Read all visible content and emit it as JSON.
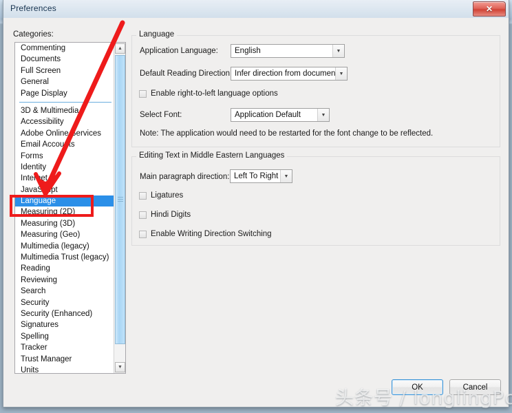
{
  "window": {
    "title": "Preferences",
    "close_label": "✕"
  },
  "sidebar": {
    "label": "Categories:",
    "items": [
      {
        "label": "Commenting",
        "selected": false
      },
      {
        "label": "Documents",
        "selected": false
      },
      {
        "label": "Full Screen",
        "selected": false
      },
      {
        "label": "General",
        "selected": false
      },
      {
        "label": "Page Display",
        "selected": false
      },
      {
        "separator": true
      },
      {
        "label": "3D & Multimedia",
        "selected": false
      },
      {
        "label": "Accessibility",
        "selected": false
      },
      {
        "label": "Adobe Online Services",
        "selected": false
      },
      {
        "label": "Email Accounts",
        "selected": false
      },
      {
        "label": "Forms",
        "selected": false
      },
      {
        "label": "Identity",
        "selected": false
      },
      {
        "label": "Internet",
        "selected": false
      },
      {
        "label": "JavaScript",
        "selected": false
      },
      {
        "label": "Language",
        "selected": true
      },
      {
        "label": "Measuring (2D)",
        "selected": false
      },
      {
        "label": "Measuring (3D)",
        "selected": false
      },
      {
        "label": "Measuring (Geo)",
        "selected": false
      },
      {
        "label": "Multimedia (legacy)",
        "selected": false
      },
      {
        "label": "Multimedia Trust (legacy)",
        "selected": false
      },
      {
        "label": "Reading",
        "selected": false
      },
      {
        "label": "Reviewing",
        "selected": false
      },
      {
        "label": "Search",
        "selected": false
      },
      {
        "label": "Security",
        "selected": false
      },
      {
        "label": "Security (Enhanced)",
        "selected": false
      },
      {
        "label": "Signatures",
        "selected": false
      },
      {
        "label": "Spelling",
        "selected": false
      },
      {
        "label": "Tracker",
        "selected": false
      },
      {
        "label": "Trust Manager",
        "selected": false
      },
      {
        "label": "Units",
        "selected": false
      }
    ],
    "scrollbar": {
      "up_glyph": "▲",
      "down_glyph": "▼"
    }
  },
  "language_group": {
    "title": "Language",
    "application_language": {
      "label": "Application Language:",
      "value": "English",
      "arrow": "▼"
    },
    "default_reading_direction": {
      "label": "Default Reading Direction:",
      "value": "Infer direction from document",
      "arrow": "▼"
    },
    "rtl_checkbox": {
      "label": "Enable right-to-left language options",
      "checked": false
    },
    "select_font": {
      "label": "Select Font:",
      "value": "Application Default",
      "arrow": "▼"
    },
    "note": "Note: The application would need to be restarted for the font change to be reflected."
  },
  "editing_group": {
    "title": "Editing Text in Middle Eastern Languages",
    "main_paragraph_direction": {
      "label": "Main paragraph direction:",
      "value": "Left To Right",
      "arrow": "▼"
    },
    "checkboxes": [
      {
        "label": "Ligatures",
        "checked": false
      },
      {
        "label": "Hindi Digits",
        "checked": false
      },
      {
        "label": "Enable Writing Direction Switching",
        "checked": false
      }
    ]
  },
  "footer": {
    "ok_label": "OK",
    "cancel_label": "Cancel"
  },
  "annotation": {
    "color": "#ee1b1b",
    "target": "Language"
  },
  "watermark": {
    "text": "头条号 / longlingPc"
  }
}
